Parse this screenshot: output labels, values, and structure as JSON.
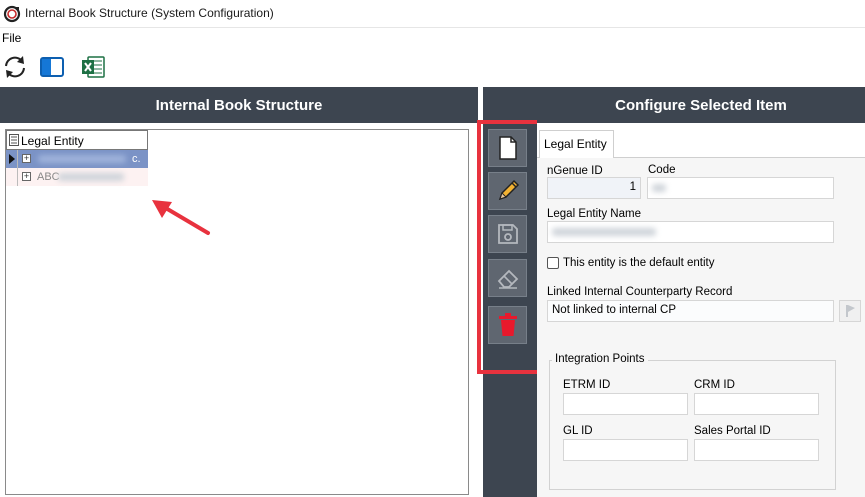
{
  "window": {
    "title": "Internal Book Structure (System Configuration)",
    "app_icon": "ngenue-logo-icon"
  },
  "menu": {
    "file": "File"
  },
  "toolbar": {
    "items": [
      "refresh-icon",
      "split-panel-icon",
      "excel-export-icon"
    ]
  },
  "left_pane": {
    "header": "Internal Book Structure",
    "grid": {
      "column": "Legal Entity",
      "rows": [
        {
          "selected": true,
          "text": "c.",
          "blurred": true
        },
        {
          "selected": false,
          "text": "ABC",
          "blurred": true
        }
      ]
    }
  },
  "side_toolbar": {
    "buttons": [
      "new-document-icon",
      "edit-pencil-icon",
      "save-disk-icon",
      "eraser-icon",
      "delete-trash-icon"
    ],
    "highlight_color": "#e8323e"
  },
  "right_pane": {
    "header": "Configure Selected Item",
    "tab": "Legal Entity",
    "form": {
      "ngenue_id_label": "nGenue ID",
      "ngenue_id_value": "1",
      "code_label": "Code",
      "code_value": "",
      "name_label": "Legal Entity Name",
      "name_value": "",
      "default_checkbox_label": "This entity is the default entity",
      "default_checked": false,
      "linked_label": "Linked Internal Counterparty Record",
      "linked_value": "Not linked to internal CP",
      "integration_group": "Integration Points",
      "etrm_label": "ETRM ID",
      "crm_label": "CRM ID",
      "gl_label": "GL ID",
      "sales_portal_label": "Sales Portal ID"
    }
  },
  "colors": {
    "header_bg": "#3d4550",
    "accent_red": "#e8323e",
    "selection_blue": "#7b93c6"
  }
}
